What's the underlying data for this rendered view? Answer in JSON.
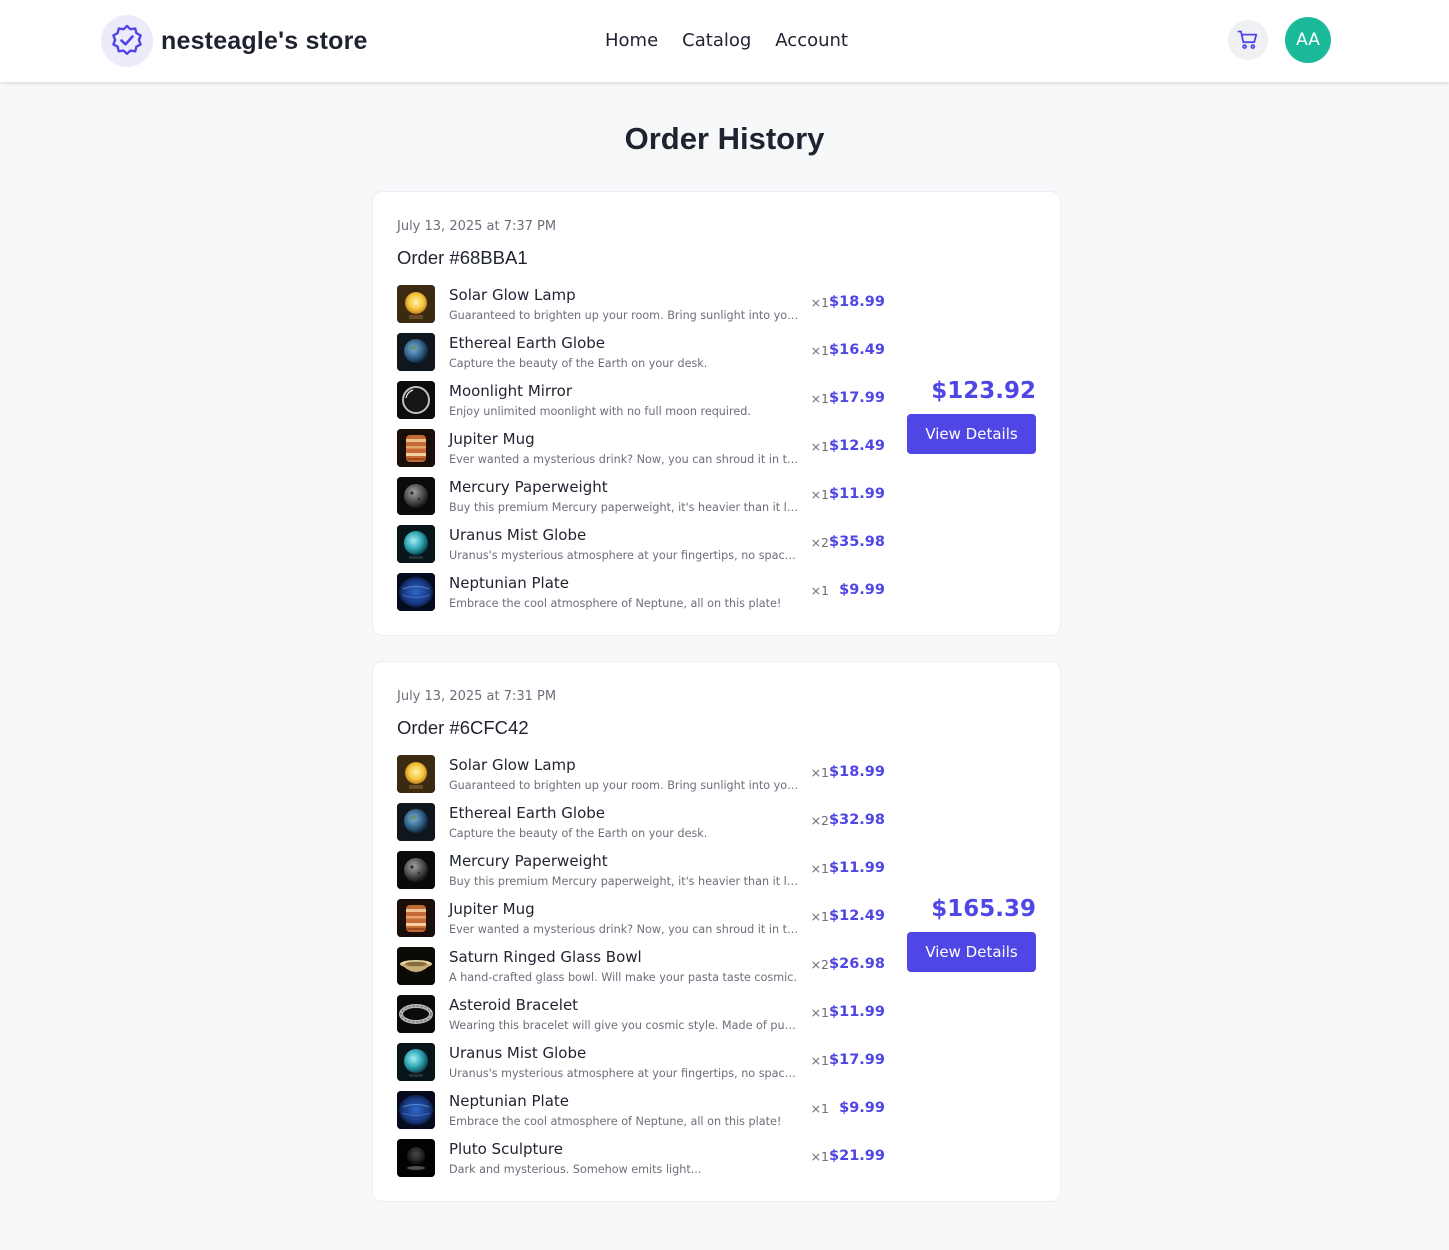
{
  "header": {
    "store_name": "nesteagle's store",
    "nav": [
      {
        "label": "Home"
      },
      {
        "label": "Catalog"
      },
      {
        "label": "Account"
      }
    ],
    "avatar_initials": "AA",
    "icons": {
      "logo": "badge-check-icon",
      "cart": "shopping-cart-icon"
    },
    "colors": {
      "accent": "#4f46e5",
      "avatar": "#19b99a"
    }
  },
  "page": {
    "title": "Order History"
  },
  "orders": [
    {
      "date": "July 13, 2025 at 7:37 PM",
      "id": "Order #68BBA1",
      "total": "$123.92",
      "button": "View Details",
      "items": [
        {
          "name": "Solar Glow Lamp",
          "desc": "Guaranteed to brighten up your room. Bring sunlight into your r...",
          "qty": "×1",
          "price": "$18.99",
          "thumb": "sun"
        },
        {
          "name": "Ethereal Earth Globe",
          "desc": "Capture the beauty of the Earth on your desk.",
          "qty": "×1",
          "price": "$16.49",
          "thumb": "earth"
        },
        {
          "name": "Moonlight Mirror",
          "desc": "Enjoy unlimited moonlight with no full moon required.",
          "qty": "×1",
          "price": "$17.99",
          "thumb": "mirror"
        },
        {
          "name": "Jupiter Mug",
          "desc": "Ever wanted a mysterious drink? Now, you can shroud it in the s...",
          "qty": "×1",
          "price": "$12.49",
          "thumb": "jupiter"
        },
        {
          "name": "Mercury Paperweight",
          "desc": "Buy this premium Mercury paperweight, it's heavier than it look...",
          "qty": "×1",
          "price": "$11.99",
          "thumb": "mercury"
        },
        {
          "name": "Uranus Mist Globe",
          "desc": "Uranus's mysterious atmosphere at your fingertips, no space sui...",
          "qty": "×2",
          "price": "$35.98",
          "thumb": "uranus"
        },
        {
          "name": "Neptunian Plate",
          "desc": "Embrace the cool atmosphere of Neptune, all on this plate!",
          "qty": "×1",
          "price": "$9.99",
          "thumb": "neptune"
        }
      ]
    },
    {
      "date": "July 13, 2025 at 7:31 PM",
      "id": "Order #6CFC42",
      "total": "$165.39",
      "button": "View Details",
      "items": [
        {
          "name": "Solar Glow Lamp",
          "desc": "Guaranteed to brighten up your room. Bring sunlight into your r...",
          "qty": "×1",
          "price": "$18.99",
          "thumb": "sun"
        },
        {
          "name": "Ethereal Earth Globe",
          "desc": "Capture the beauty of the Earth on your desk.",
          "qty": "×2",
          "price": "$32.98",
          "thumb": "earth"
        },
        {
          "name": "Mercury Paperweight",
          "desc": "Buy this premium Mercury paperweight, it's heavier than it look...",
          "qty": "×1",
          "price": "$11.99",
          "thumb": "mercury"
        },
        {
          "name": "Jupiter Mug",
          "desc": "Ever wanted a mysterious drink? Now, you can shroud it in the s...",
          "qty": "×1",
          "price": "$12.49",
          "thumb": "jupiter"
        },
        {
          "name": "Saturn Ringed Glass Bowl",
          "desc": "A hand-crafted glass bowl. Will make your pasta taste cosmic.",
          "qty": "×2",
          "price": "$26.98",
          "thumb": "bowl"
        },
        {
          "name": "Asteroid Bracelet",
          "desc": "Wearing this bracelet will give you cosmic style. Made of pure ...",
          "qty": "×1",
          "price": "$11.99",
          "thumb": "bracelet"
        },
        {
          "name": "Uranus Mist Globe",
          "desc": "Uranus's mysterious atmosphere at your fingertips, no space sui...",
          "qty": "×1",
          "price": "$17.99",
          "thumb": "uranus"
        },
        {
          "name": "Neptunian Plate",
          "desc": "Embrace the cool atmosphere of Neptune, all on this plate!",
          "qty": "×1",
          "price": "$9.99",
          "thumb": "neptune"
        },
        {
          "name": "Pluto Sculpture",
          "desc": "Dark and mysterious. Somehow emits light...",
          "qty": "×1",
          "price": "$21.99",
          "thumb": "pluto"
        }
      ]
    }
  ]
}
